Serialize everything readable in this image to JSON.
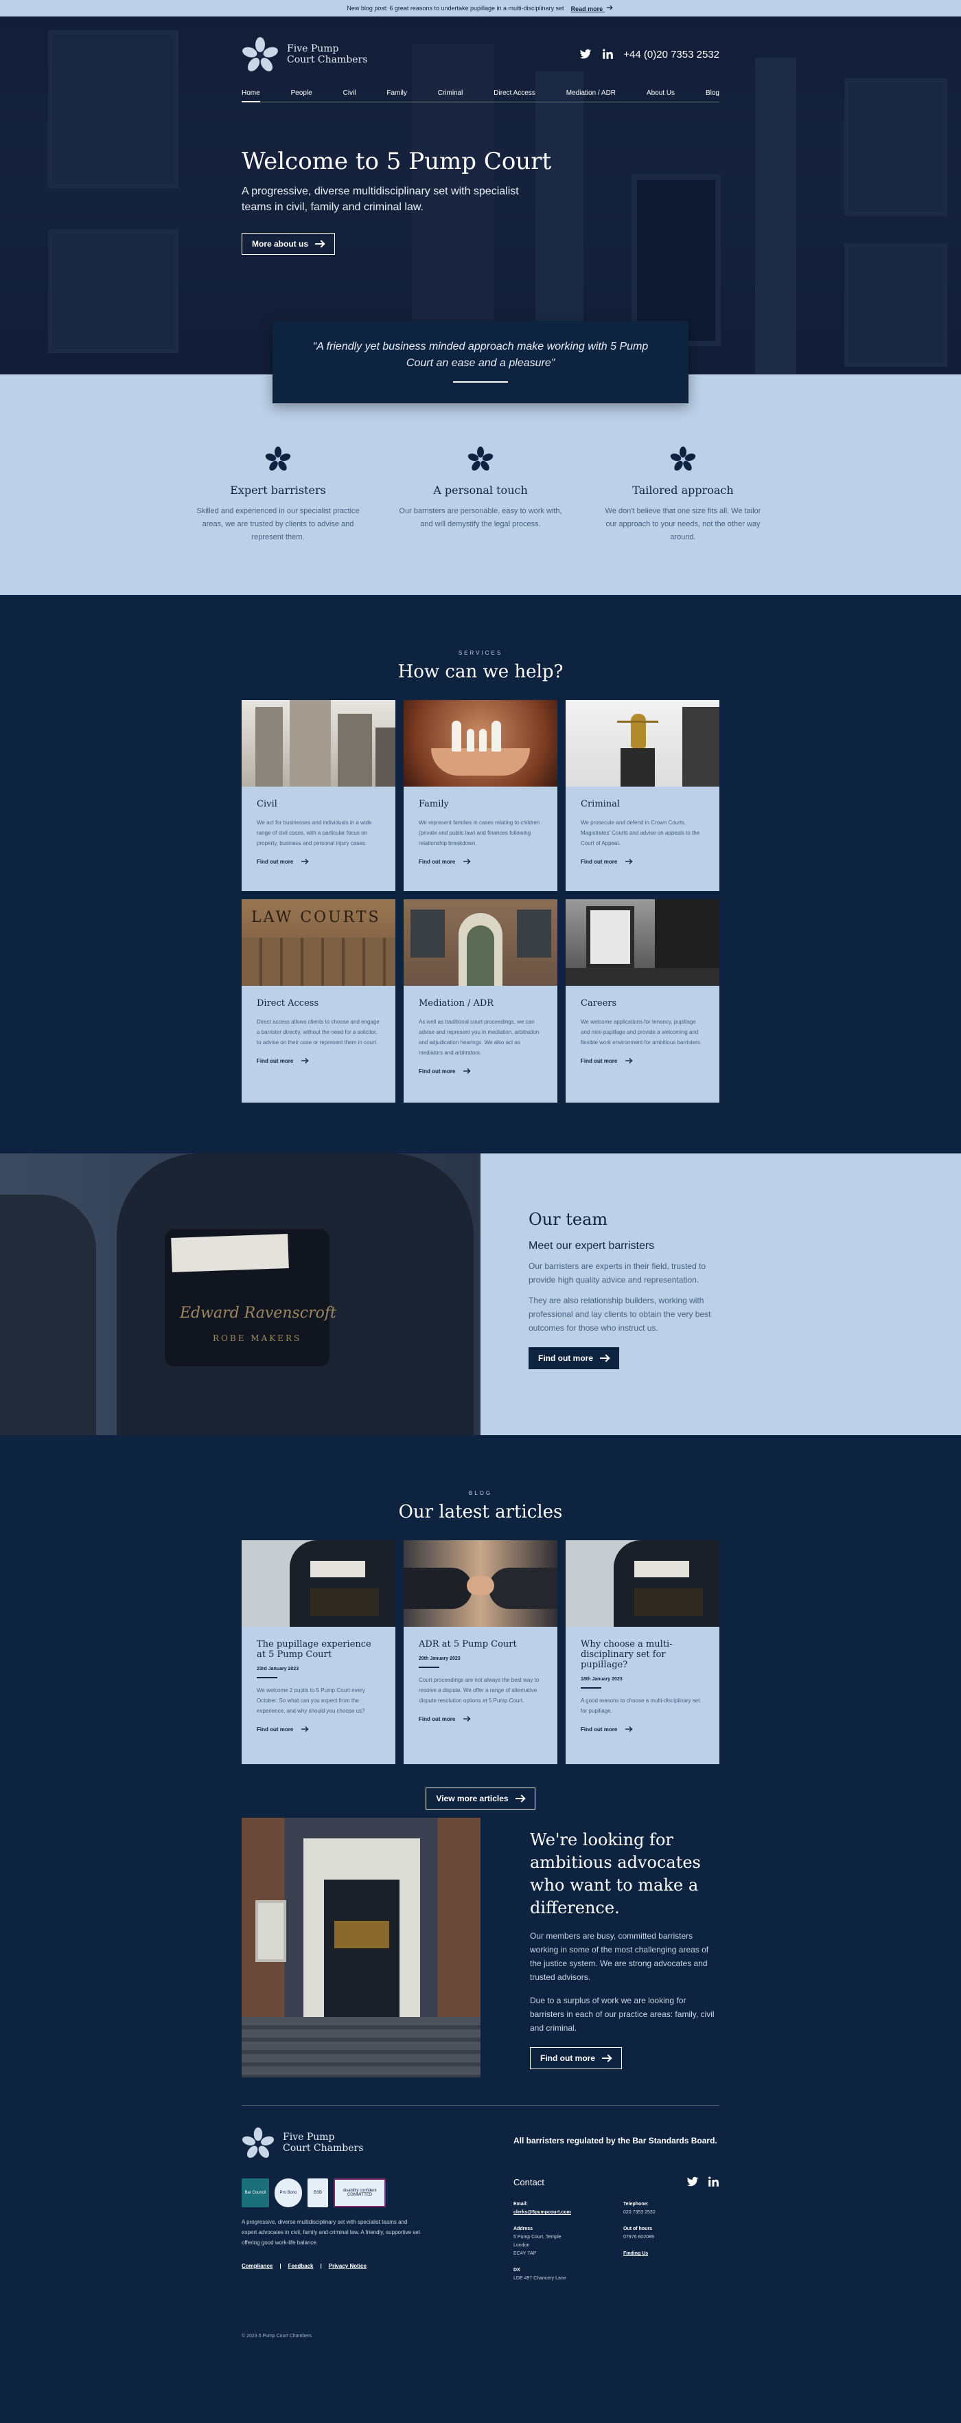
{
  "announcement": {
    "text": "New blog post: 6 great reasons to undertake pupillage in a multi-disciplinary set",
    "link": "Read more"
  },
  "brand": {
    "line1": "Five Pump",
    "line2": "Court Chambers",
    "phone": "+44 (0)20 7353 2532"
  },
  "nav": [
    "Home",
    "People",
    "Civil",
    "Family",
    "Criminal",
    "Direct Access",
    "Mediation / ADR",
    "About Us",
    "Blog"
  ],
  "hero": {
    "title": "Welcome to 5 Pump Court",
    "subtitle": "A progressive, diverse multidisciplinary set with specialist teams in civil, family and criminal law.",
    "cta": "More about us"
  },
  "quote": "“A friendly yet business minded approach make working with 5 Pump Court an ease and a pleasure”",
  "features": [
    {
      "title": "Expert barristers",
      "text": "Skilled and experienced in our specialist practice areas, we are trusted by clients to advise and represent them."
    },
    {
      "title": "A personal touch",
      "text": "Our barristers are personable, easy to work with, and will demystify the legal process."
    },
    {
      "title": "Tailored approach",
      "text": "We don't believe that one size fits all. We tailor our approach to your needs, not the other way around."
    }
  ],
  "services": {
    "eyebrow": "SERVICES",
    "title": "How can we help?",
    "more": "Find out more",
    "items": [
      {
        "title": "Civil",
        "text": "We act for businesses and individuals in a wide range of civil cases, with a particular focus on property, business and personal injury cases."
      },
      {
        "title": "Family",
        "text": "We represent families in cases relating to children (private and public law) and finances following relationship breakdown."
      },
      {
        "title": "Criminal",
        "text": "We prosecute and defend in Crown Courts, Magistrates' Courts and advise on appeals to the Court of Appeal."
      },
      {
        "title": "Direct Access",
        "text": "Direct access allows clients to choose and engage a barrister directly, without the need for a solicitor, to advise on their case or represent them in court."
      },
      {
        "title": "Mediation / ADR",
        "text": "As well as traditional court proceedings, we can advise and represent you in mediation, arbitration and adjudication hearings. We also act as mediators and arbitrators."
      },
      {
        "title": "Careers",
        "text": "We welcome applications for tenancy, pupillage and mini-pupillage and provide a welcoming and flexible work environment for ambitious barristers."
      }
    ],
    "court_sign": "LAW COURTS"
  },
  "team": {
    "title": "Our team",
    "subtitle": "Meet our expert barristers",
    "p1": "Our barristers are experts in their field, trusted to provide high quality advice and representation.",
    "p2": "They are also relationship builders, working with professional and lay clients to obtain the very best outcomes for those who instruct us.",
    "cta": "Find out more",
    "label_line1": "Edward Ravenscroft",
    "label_line2": "ROBE MAKERS"
  },
  "blog": {
    "eyebrow": "BLOG",
    "title": "Our latest articles",
    "more": "Find out more",
    "cta": "View more articles",
    "posts": [
      {
        "title": "The pupillage experience at 5 Pump Court",
        "date": "23rd January 2023",
        "text": "We welcome 2 pupils to 5 Pump Court every October. So what can you expect from the experience, and why should you choose us?"
      },
      {
        "title": "ADR at 5 Pump Court",
        "date": "20th January 2023",
        "text": "Court proceedings are not always the best way to resolve a dispute. We offer a range of alternative dispute resolution options at 5 Pump Court."
      },
      {
        "title": "Why choose a multi-disciplinary set for pupillage?",
        "date": "18th January 2023",
        "text": "A good reasons to choose a multi-disciplinary set for pupillage."
      }
    ]
  },
  "recruit": {
    "title": "We're looking for ambitious advocates who want to make a difference.",
    "p1": "Our members are busy, committed barristers working in some of the most challenging areas of the justice system. We are strong advocates and trusted advisors.",
    "p2": "Due to a surplus of work we are looking for barristers in each of our practice areas: family, civil and criminal.",
    "cta": "Find out more"
  },
  "footer": {
    "regulated": "All barristers regulated by the Bar Standards Board.",
    "blurb": "A progressive, diverse multidisciplinary set with specialist teams and expert advocates in civil, family and criminal law. A friendly, supportive set offering good work-life balance.",
    "links": [
      "Compliance",
      "Feedback",
      "Privacy Notice"
    ],
    "copyright": "© 2023 5 Pump Court Chambers",
    "contact_title": "Contact",
    "email_label": "Email:",
    "email": "clerks@5pumpcourt.com",
    "telephone_label": "Telephone:",
    "telephone": "020 7353 2532",
    "address_label": "Address",
    "address": [
      "5 Pump Court, Temple",
      "London",
      "EC4Y 7AP"
    ],
    "ooh_label": "Out of hours",
    "ooh": "07976 602089",
    "finding": "Finding Us",
    "dx_label": "DX",
    "dx": "LDE 497 Chancery Lane",
    "badges": [
      "Bar Council",
      "Pro Bono",
      "BSB",
      "disability confident COMMITTED"
    ]
  },
  "colors": {
    "navy": "#0e2340",
    "light_blue": "#bcd0e8",
    "muted_text": "#47607e"
  }
}
